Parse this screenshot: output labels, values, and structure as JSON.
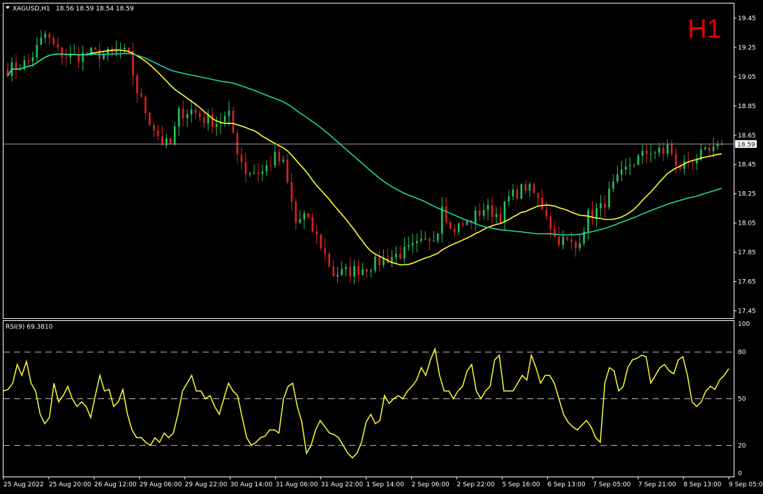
{
  "header": {
    "symbol": "XAGUSD,H1",
    "ohlc": "18.56 18.59 18.54 18.59",
    "timeframe_badge": "H1"
  },
  "indicator": {
    "label": "RSI(9) 69.3810"
  },
  "colors": {
    "background": "#000000",
    "frame": "#ffffff",
    "bull": "#22c55e",
    "bear": "#e02020",
    "ma_fast": "#ffff33",
    "ma_slow": "#22d3a0",
    "rsi": "#ffff33",
    "timeframe": "#e00000"
  },
  "chart_data": [
    {
      "type": "candlestick",
      "symbol": "XAGUSD",
      "timeframe": "H1",
      "last_price": 18.59,
      "ylim": [
        17.4,
        19.55
      ],
      "y_ticks": [
        17.45,
        17.65,
        17.85,
        18.05,
        18.25,
        18.45,
        18.65,
        18.85,
        19.05,
        19.25,
        19.45
      ],
      "x_ticks": [
        "25 Aug 2022",
        "25 Aug 20:00",
        "26 Aug 12:00",
        "29 Aug 06:00",
        "29 Aug 22:00",
        "30 Aug 14:00",
        "31 Aug 06:00",
        "31 Aug 22:00",
        "1 Sep 14:00",
        "2 Sep 06:00",
        "2 Sep 22:00",
        "5 Sep 16:00",
        "6 Sep 13:00",
        "7 Sep 05:00",
        "7 Sep 21:00",
        "8 Sep 13:00",
        "9 Sep 05:00"
      ],
      "price_path": [
        [
          0,
          19.1
        ],
        [
          5,
          19.15
        ],
        [
          9,
          19.34
        ],
        [
          12,
          19.22
        ],
        [
          15,
          19.18
        ],
        [
          20,
          19.21
        ],
        [
          25,
          19.2
        ],
        [
          27,
          19.23
        ],
        [
          29,
          19.19
        ],
        [
          31,
          18.95
        ],
        [
          34,
          18.75
        ],
        [
          37,
          18.6
        ],
        [
          39,
          18.58
        ],
        [
          41,
          18.8
        ],
        [
          44,
          18.82
        ],
        [
          47,
          18.76
        ],
        [
          50,
          18.74
        ],
        [
          53,
          18.78
        ],
        [
          55,
          18.55
        ],
        [
          57,
          18.4
        ],
        [
          61,
          18.4
        ],
        [
          64,
          18.5
        ],
        [
          66,
          18.45
        ],
        [
          69,
          18.05
        ],
        [
          71,
          18.1
        ],
        [
          75,
          17.9
        ],
        [
          78,
          17.7
        ],
        [
          82,
          17.72
        ],
        [
          86,
          17.75
        ],
        [
          90,
          17.8
        ],
        [
          95,
          17.85
        ],
        [
          100,
          17.92
        ],
        [
          103,
          18.0
        ],
        [
          104,
          18.2
        ],
        [
          106,
          18.0
        ],
        [
          110,
          18.05
        ],
        [
          114,
          18.15
        ],
        [
          118,
          18.1
        ],
        [
          120,
          18.22
        ],
        [
          124,
          18.3
        ],
        [
          126,
          18.25
        ],
        [
          129,
          18.12
        ],
        [
          131,
          17.95
        ],
        [
          134,
          17.92
        ],
        [
          136,
          17.88
        ],
        [
          139,
          18.1
        ],
        [
          142,
          18.15
        ],
        [
          145,
          18.3
        ],
        [
          149,
          18.45
        ],
        [
          154,
          18.55
        ],
        [
          157,
          18.52
        ],
        [
          158,
          18.6
        ],
        [
          160,
          18.42
        ],
        [
          165,
          18.5
        ],
        [
          170,
          18.55
        ],
        [
          171,
          18.58
        ]
      ],
      "moving_averages": [
        {
          "period": 20,
          "color": "#ffff33"
        },
        {
          "period": 60,
          "color": "#22d3a0"
        }
      ]
    },
    {
      "type": "line",
      "indicator": "RSI",
      "period": 9,
      "current_value": 69.381,
      "ylim": [
        0,
        100
      ],
      "y_ticks": [
        0,
        20,
        50,
        80,
        100
      ],
      "levels": [
        20,
        50,
        80
      ],
      "values": [
        55,
        56,
        60,
        72,
        65,
        74,
        60,
        55,
        40,
        34,
        38,
        60,
        48,
        52,
        58,
        50,
        45,
        48,
        45,
        38,
        52,
        65,
        55,
        56,
        45,
        48,
        56,
        40,
        30,
        25,
        25,
        22,
        20,
        25,
        22,
        28,
        25,
        28,
        40,
        55,
        60,
        65,
        55,
        55,
        50,
        52,
        45,
        40,
        50,
        60,
        55,
        52,
        38,
        25,
        20,
        22,
        25,
        26,
        30,
        30,
        28,
        50,
        58,
        60,
        45,
        35,
        15,
        20,
        30,
        36,
        32,
        28,
        27,
        25,
        20,
        15,
        12,
        15,
        22,
        35,
        40,
        34,
        36,
        52,
        47,
        50,
        52,
        50,
        55,
        58,
        62,
        70,
        65,
        75,
        82,
        65,
        55,
        55,
        50,
        55,
        58,
        68,
        72,
        55,
        50,
        55,
        58,
        75,
        78,
        55,
        55,
        55,
        60,
        65,
        62,
        78,
        70,
        60,
        65,
        65,
        60,
        50,
        40,
        35,
        32,
        30,
        33,
        36,
        32,
        25,
        22,
        60,
        70,
        68,
        55,
        58,
        70,
        75,
        76,
        78,
        77,
        60,
        65,
        70,
        72,
        68,
        66,
        75,
        77,
        65,
        48,
        45,
        48,
        55,
        58,
        56,
        62,
        65,
        69.4
      ]
    }
  ]
}
